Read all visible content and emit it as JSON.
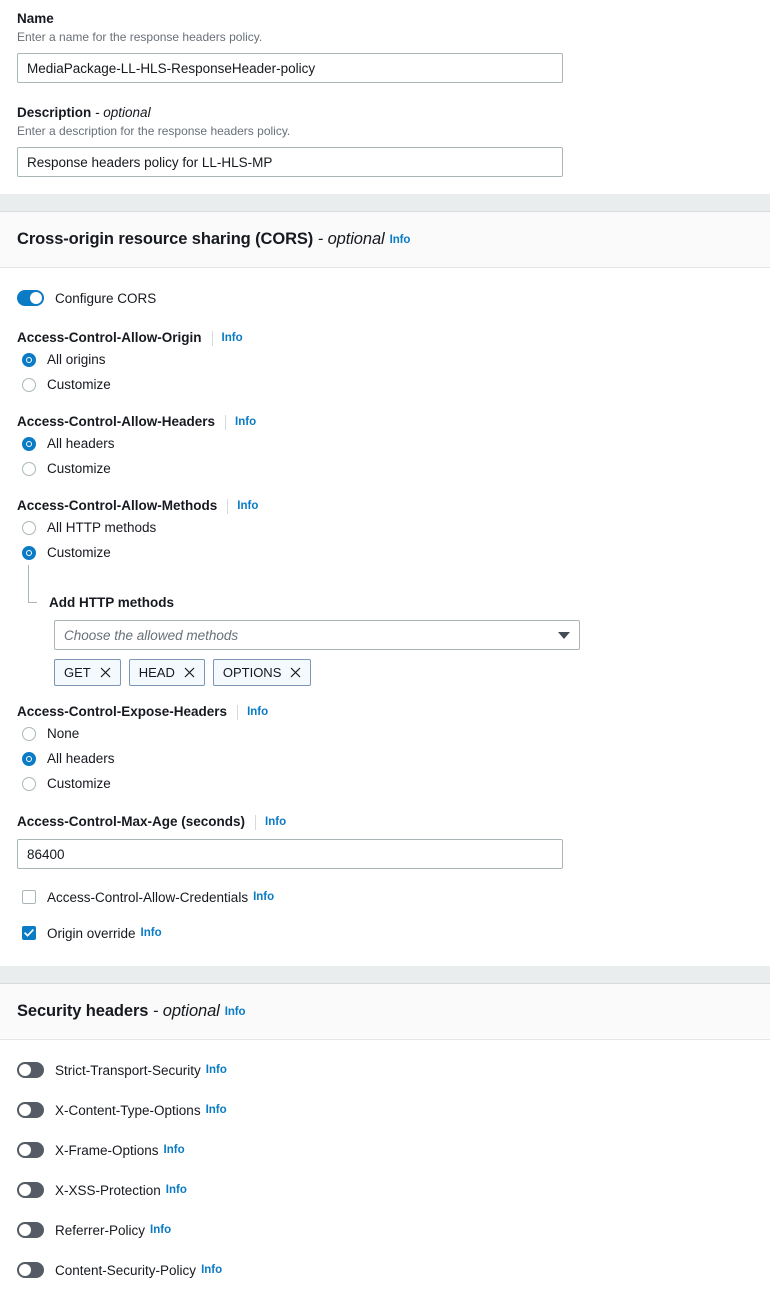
{
  "colors": {
    "accent": "#0a7bc4",
    "link": "#0a7bc4",
    "toggle_off": "#545b64",
    "band": "#fafafa",
    "gap": "#eaeded",
    "border": "#aab7b8",
    "hint_text": "#687078",
    "chip_bg": "#f4f9fd",
    "chip_border": "#7d96b5"
  },
  "info_label": "Info",
  "name_field": {
    "label": "Name",
    "hint": "Enter a name for the response headers policy.",
    "value": "MediaPackage-LL-HLS-ResponseHeader-policy",
    "placeholder": ""
  },
  "description_field": {
    "label": "Description",
    "optional_suffix": "- optional",
    "hint": "Enter a description for the response headers policy.",
    "value": "Response headers policy for LL-HLS-MP",
    "placeholder": ""
  },
  "cors_section": {
    "title": "Cross-origin resource sharing (CORS)",
    "optional_suffix": "- optional",
    "info": "Info",
    "configure_toggle": {
      "label": "Configure CORS",
      "state": "on",
      "icon": "toggle-on-icon"
    },
    "allow_origin": {
      "label": "Access-Control-Allow-Origin",
      "info": "Info",
      "options": [
        {
          "label": "All origins",
          "selected": true
        },
        {
          "label": "Customize",
          "selected": false
        }
      ]
    },
    "allow_headers": {
      "label": "Access-Control-Allow-Headers",
      "info": "Info",
      "options": [
        {
          "label": "All headers",
          "selected": true
        },
        {
          "label": "Customize",
          "selected": false
        }
      ]
    },
    "allow_methods": {
      "label": "Access-Control-Allow-Methods",
      "info": "Info",
      "options": [
        {
          "label": "All HTTP methods",
          "selected": false
        },
        {
          "label": "Customize",
          "selected": true
        }
      ],
      "nested": {
        "label": "Add HTTP methods",
        "select_placeholder": "Choose the allowed methods",
        "select_value": "",
        "caret_icon": "chevron-down-icon",
        "chips": [
          {
            "label": "GET",
            "dismiss_icon": "close-icon"
          },
          {
            "label": "HEAD",
            "dismiss_icon": "close-icon"
          },
          {
            "label": "OPTIONS",
            "dismiss_icon": "close-icon"
          }
        ]
      }
    },
    "expose_headers": {
      "label": "Access-Control-Expose-Headers",
      "info": "Info",
      "options": [
        {
          "label": "None",
          "selected": false
        },
        {
          "label": "All headers",
          "selected": true
        },
        {
          "label": "Customize",
          "selected": false
        }
      ]
    },
    "max_age": {
      "label": "Access-Control-Max-Age (seconds)",
      "info": "Info",
      "value": "86400",
      "placeholder": ""
    },
    "checkboxes": [
      {
        "label": "Access-Control-Allow-Credentials",
        "info": "Info",
        "checked": false
      },
      {
        "label": "Origin override",
        "info": "Info",
        "checked": true
      }
    ]
  },
  "security_section": {
    "title": "Security headers",
    "optional_suffix": "- optional",
    "info": "Info",
    "toggles": [
      {
        "label": "Strict-Transport-Security",
        "info": "Info",
        "state": "off"
      },
      {
        "label": "X-Content-Type-Options",
        "info": "Info",
        "state": "off"
      },
      {
        "label": "X-Frame-Options",
        "info": "Info",
        "state": "off"
      },
      {
        "label": "X-XSS-Protection",
        "info": "Info",
        "state": "off"
      },
      {
        "label": "Referrer-Policy",
        "info": "Info",
        "state": "off"
      },
      {
        "label": "Content-Security-Policy",
        "info": "Info",
        "state": "off"
      }
    ]
  }
}
